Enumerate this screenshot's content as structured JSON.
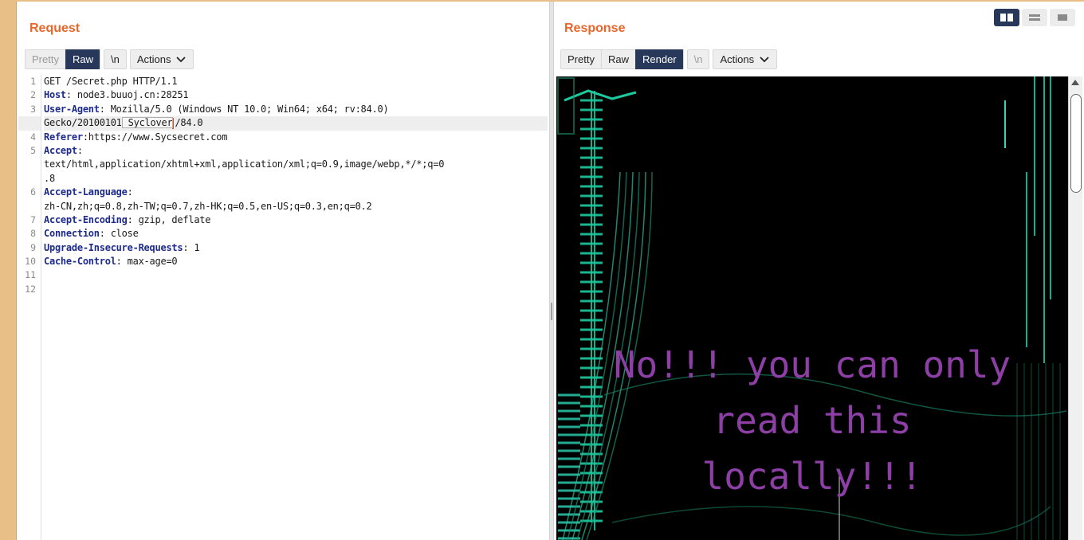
{
  "request": {
    "title": "Request",
    "toolbar": {
      "pretty": "Pretty",
      "raw": "Raw",
      "newline": "\\n",
      "actions": "Actions"
    },
    "line_numbers": [
      "1",
      "2",
      "3",
      "",
      "4",
      "5",
      "",
      "",
      "6",
      "",
      "7",
      "8",
      "9",
      "10",
      "11",
      "12"
    ],
    "lines": {
      "l1": "GET /Secret.php HTTP/1.1",
      "l2_name": "Host",
      "l2_value": ": node3.buuoj.cn:28251",
      "l3_name": "User-Agent",
      "l3_value": ": Mozilla/5.0 (Windows NT 10.0; Win64; x64; rv:84.0)",
      "l3b_pre": "Gecko/20100101",
      "l3b_sel": " Syclover",
      "l3b_post": "/84.0",
      "l4_name": "Referer",
      "l4_value": ":https://www.Sycsecret.com",
      "l5_name": "Accept",
      "l5_colon": ":",
      "l5b": "text/html,application/xhtml+xml,application/xml;q=0.9,image/webp,*/*;q=0",
      "l5c": ".8",
      "l6_name": "Accept-Language",
      "l6_colon": ":",
      "l6b": "zh-CN,zh;q=0.8,zh-TW;q=0.7,zh-HK;q=0.5,en-US;q=0.3,en;q=0.2",
      "l7_name": "Accept-Encoding",
      "l7_value": ": gzip, deflate",
      "l8_name": "Connection",
      "l8_value": ": close",
      "l9_name": "Upgrade-Insecure-Requests",
      "l9_value": ": 1",
      "l10_name": "Cache-Control",
      "l10_value": ": max-age=0"
    }
  },
  "response": {
    "title": "Response",
    "toolbar": {
      "pretty": "Pretty",
      "raw": "Raw",
      "render": "Render",
      "newline": "\\n",
      "actions": "Actions"
    },
    "render_text": [
      "No!!! you can only",
      "read this",
      "locally!!!"
    ]
  },
  "colors": {
    "accent": "#e8662a",
    "active_button": "#27385a",
    "header_name": "#1d2b8a",
    "render_text": "#8e3fa6",
    "matrix_green": "#1fc9a0"
  },
  "icons": {
    "actions_chevron": "chevron-down-icon",
    "layout_split": "columns-icon",
    "layout_rows": "rows-icon",
    "layout_single": "single-pane-icon"
  }
}
